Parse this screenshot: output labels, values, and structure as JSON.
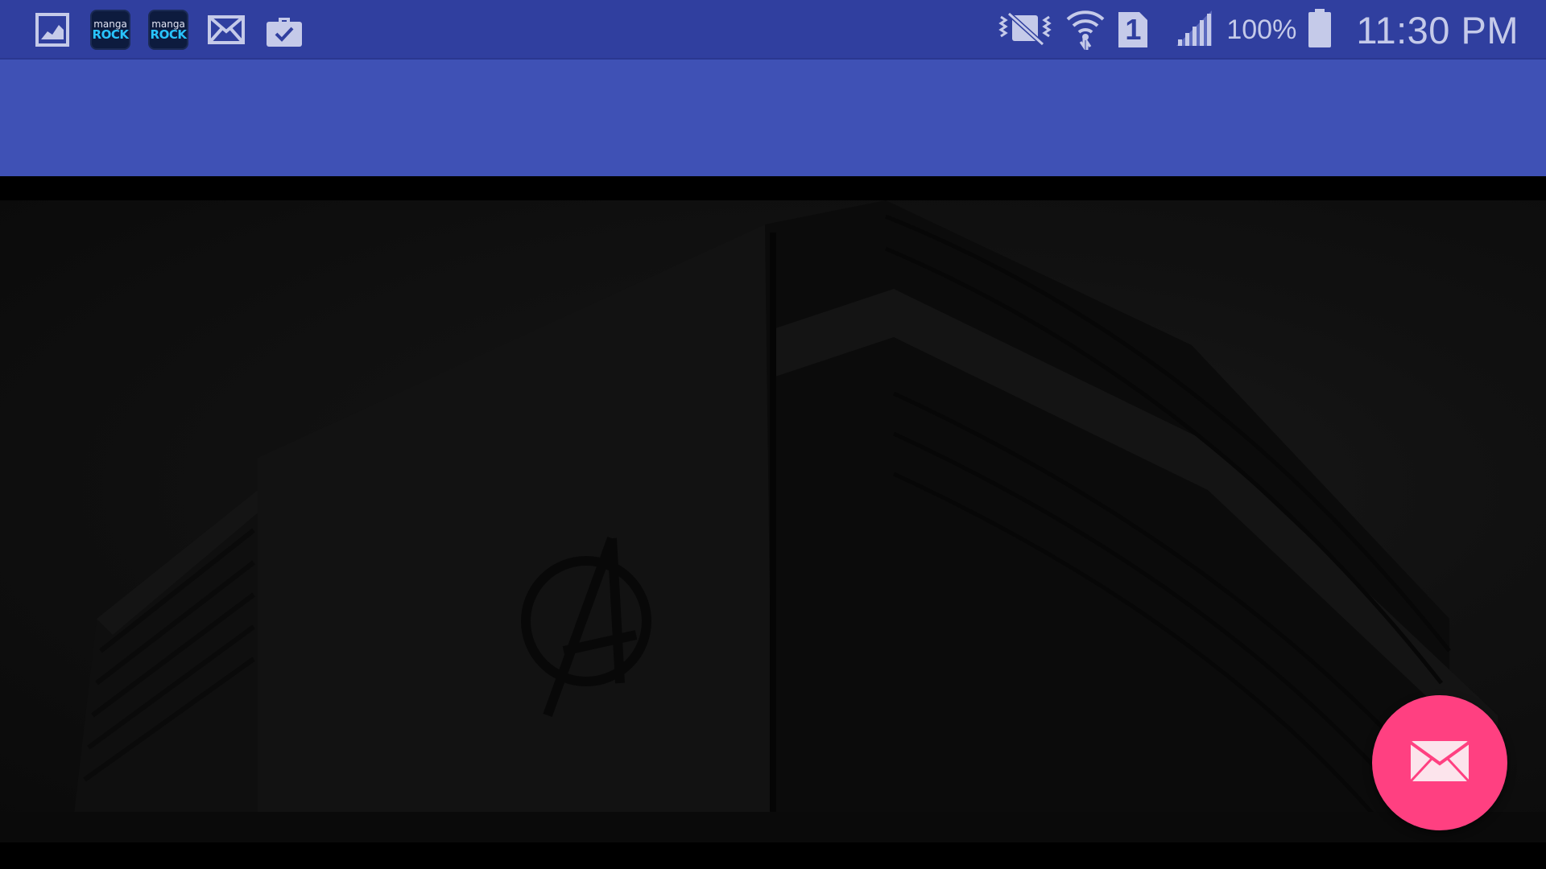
{
  "status_bar": {
    "notifications": [
      {
        "icon": "gallery-icon"
      },
      {
        "icon": "manga-rock-icon",
        "label_small": "manga",
        "label_big": "ROCK"
      },
      {
        "icon": "manga-rock-icon",
        "label_small": "manga",
        "label_big": "ROCK"
      },
      {
        "icon": "mail-icon"
      },
      {
        "icon": "task-briefcase-icon"
      }
    ],
    "system": {
      "vibrate_icon": "vibrate-silent-icon",
      "wifi_icon": "wifi-icon",
      "sim_icon": "sim-1-icon",
      "sim_label": "1",
      "signal_icon": "cell-signal-icon",
      "battery_percent": "100%",
      "battery_icon": "battery-full-icon",
      "time": "11:30 PM"
    }
  },
  "app_bar": {
    "title": ""
  },
  "content": {
    "image": "dark-building-with-avengers-logo"
  },
  "fab": {
    "icon": "mail-icon",
    "color": "#ff4081"
  },
  "colors": {
    "status_bar": "#303f9f",
    "app_bar": "#3f51b5",
    "status_text": "#c5cae9"
  }
}
